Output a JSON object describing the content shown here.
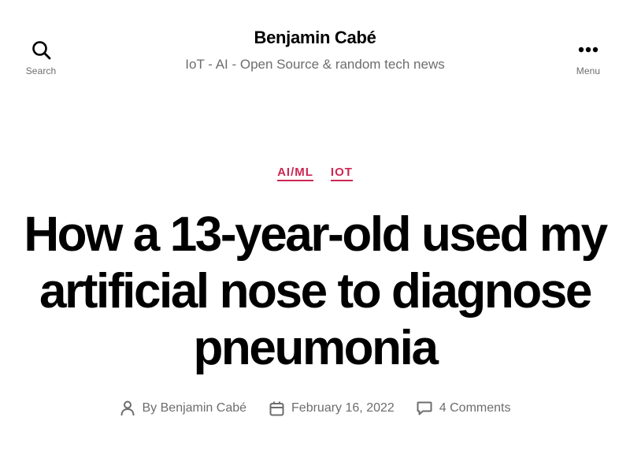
{
  "header": {
    "search_label": "Search",
    "menu_label": "Menu",
    "site_title": "Benjamin Cabé",
    "tagline": "IoT - AI - Open Source & random tech news"
  },
  "post": {
    "categories": [
      "AI/ML",
      "IOT"
    ],
    "title": "How a 13-year-old used my artificial nose to diagnose pneumonia",
    "author_prefix": "By",
    "author": "Benjamin Cabé",
    "date": "February 16, 2022",
    "comments": "4 Comments"
  },
  "colors": {
    "accent": "#cd2653",
    "secondary_text": "#6d6d6d",
    "background": "#ffffff"
  },
  "icons": {
    "search": "search-icon",
    "menu": "ellipsis-icon",
    "author": "person-icon",
    "date": "calendar-icon",
    "comments": "comment-bubble-icon"
  }
}
